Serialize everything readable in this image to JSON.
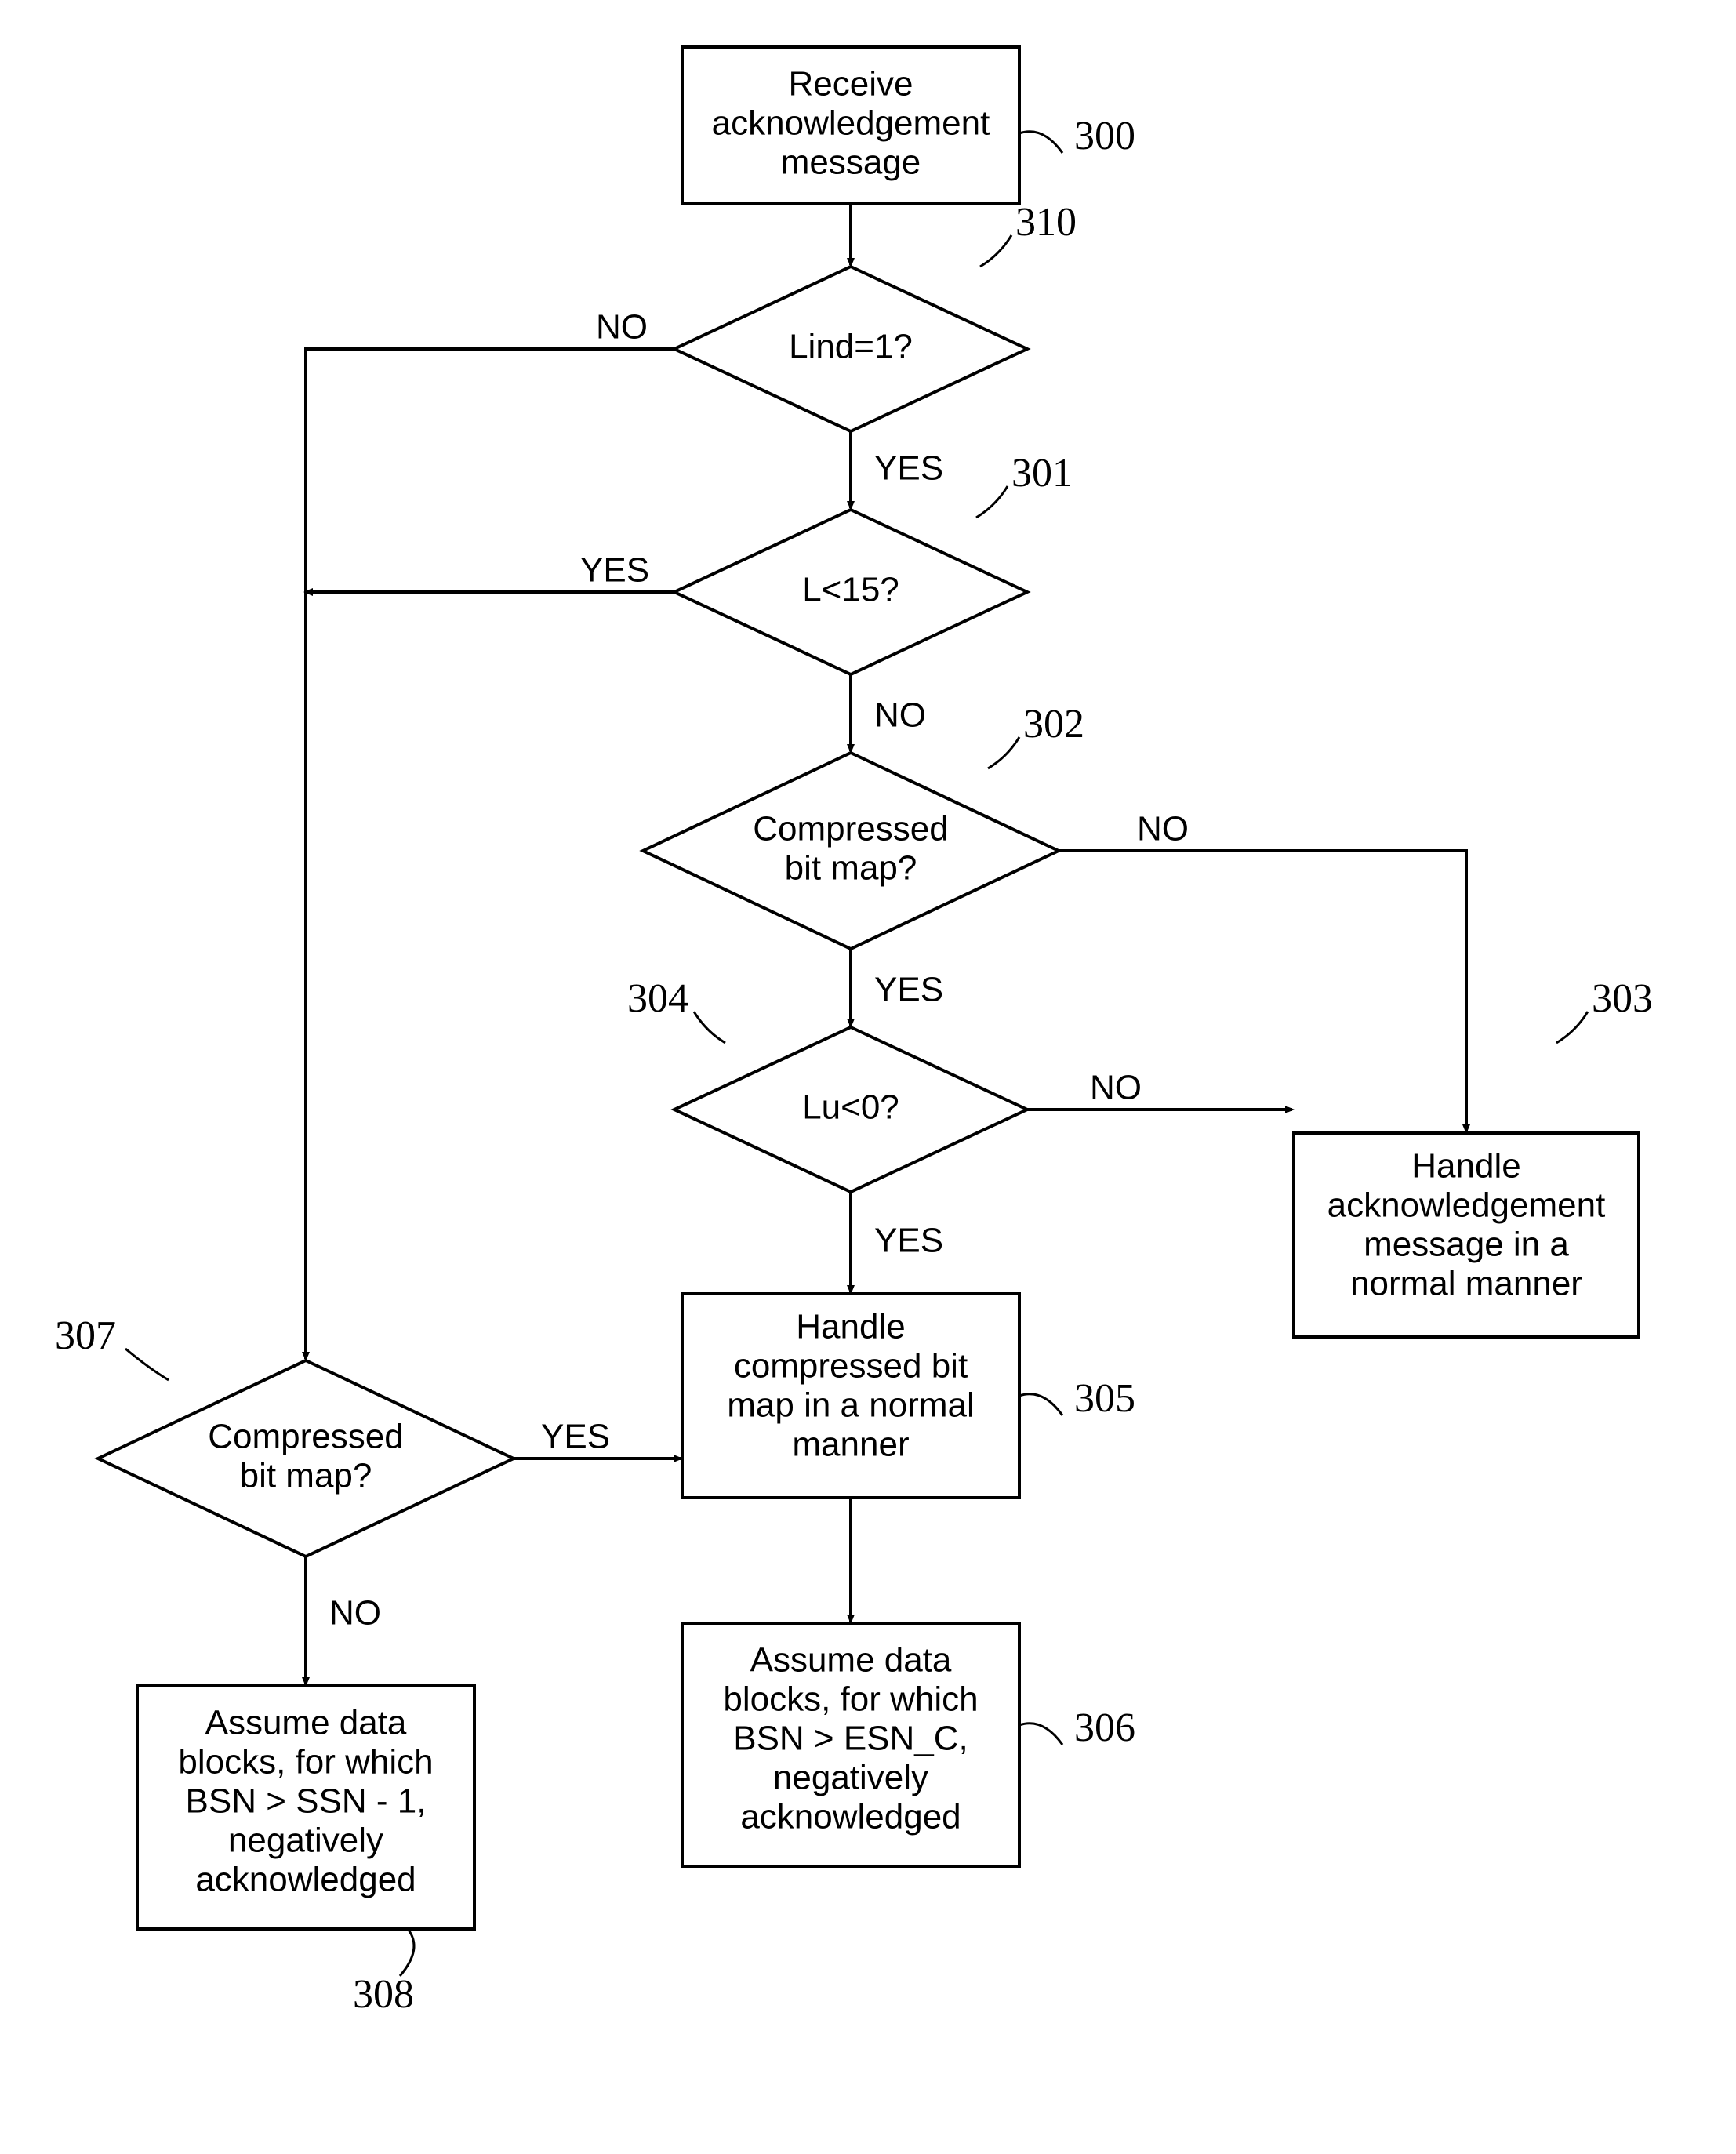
{
  "nodes": {
    "n300": {
      "l1": "Receive",
      "l2": "acknowledgement",
      "l3": "message",
      "ref": "300"
    },
    "n310": {
      "text": "Lind=1?",
      "ref": "310"
    },
    "n301": {
      "text": "L<15?",
      "ref": "301"
    },
    "n302": {
      "l1": "Compressed",
      "l2": "bit map?",
      "ref": "302"
    },
    "n304": {
      "text": "Lu<0?",
      "ref": "304"
    },
    "n303": {
      "l1": "Handle",
      "l2": "acknowledgement",
      "l3": "message in a",
      "l4": "normal manner",
      "ref": "303"
    },
    "n305": {
      "l1": "Handle",
      "l2": "compressed bit",
      "l3": "map in a normal",
      "l4": "manner",
      "ref": "305"
    },
    "n306": {
      "l1": "Assume data",
      "l2": "blocks, for which",
      "l3": "BSN > ESN_C,",
      "l4": "negatively",
      "l5": "acknowledged",
      "ref": "306"
    },
    "n307": {
      "l1": "Compressed",
      "l2": "bit map?",
      "ref": "307"
    },
    "n308": {
      "l1": "Assume data",
      "l2": "blocks, for which",
      "l3": "BSN > SSN - 1,",
      "l4": "negatively",
      "l5": "acknowledged",
      "ref": "308"
    }
  },
  "labels": {
    "yes": "YES",
    "no": "NO"
  }
}
